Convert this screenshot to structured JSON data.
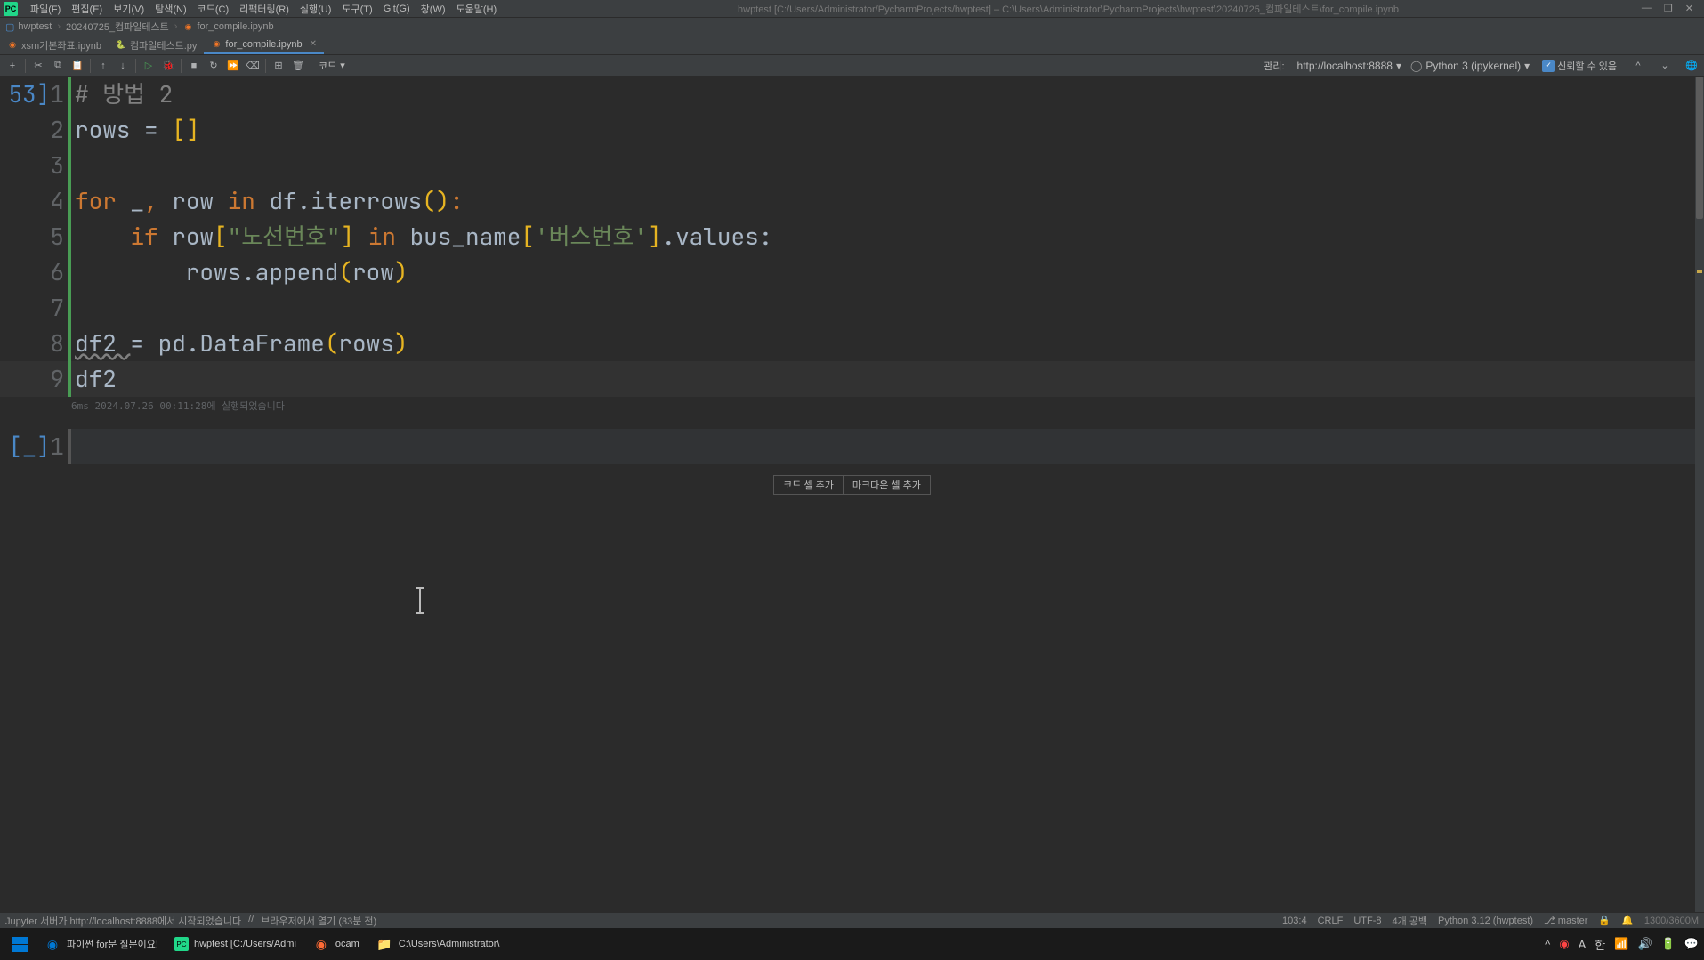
{
  "menubar": {
    "items": [
      "파일(F)",
      "편집(E)",
      "보기(V)",
      "탐색(N)",
      "코드(C)",
      "리팩터링(R)",
      "실행(U)",
      "도구(T)",
      "Git(G)",
      "창(W)",
      "도움말(H)"
    ],
    "title": "hwptest [C:/Users/Administrator/PycharmProjects/hwptest] – C:\\Users\\Administrator\\PycharmProjects\\hwptest\\20240725_컴파일테스트\\for_compile.ipynb"
  },
  "breadcrumb": {
    "items": [
      "hwptest",
      "20240725_컴파일테스트",
      "for_compile.ipynb"
    ]
  },
  "tabs": [
    {
      "name": "xsm기본좌표.ipynb",
      "type": "jupyter",
      "active": false
    },
    {
      "name": "컴파일테스트.py",
      "type": "python",
      "active": false
    },
    {
      "name": "for_compile.ipynb",
      "type": "jupyter",
      "active": true
    }
  ],
  "toolbar": {
    "cell_type": "코드",
    "manage_label": "관리:",
    "server": "http://localhost:8888",
    "kernel": "Python 3 (ipykernel)",
    "trust_label": "신뢰할 수 있음"
  },
  "code_cell": {
    "exec_count": "53",
    "lines": [
      {
        "n": "1",
        "tokens": [
          {
            "t": "# 방법 2",
            "c": "comment"
          }
        ]
      },
      {
        "n": "2",
        "tokens": [
          {
            "t": "rows ",
            "c": "identifier"
          },
          {
            "t": "= ",
            "c": "identifier"
          },
          {
            "t": "[",
            "c": "bracket-y"
          },
          {
            "t": "]",
            "c": "bracket-y"
          }
        ]
      },
      {
        "n": "3",
        "tokens": []
      },
      {
        "n": "4",
        "tokens": [
          {
            "t": "for ",
            "c": "keyword"
          },
          {
            "t": "_",
            "c": "identifier"
          },
          {
            "t": ", ",
            "c": "keyword"
          },
          {
            "t": "row ",
            "c": "identifier"
          },
          {
            "t": "in ",
            "c": "keyword"
          },
          {
            "t": "df.iterrows",
            "c": "identifier"
          },
          {
            "t": "(",
            "c": "bracket-y"
          },
          {
            "t": ")",
            "c": "bracket-y"
          },
          {
            "t": ":",
            "c": "keyword"
          }
        ]
      },
      {
        "n": "5",
        "tokens": [
          {
            "t": "    ",
            "c": ""
          },
          {
            "t": "if ",
            "c": "keyword"
          },
          {
            "t": "row",
            "c": "identifier"
          },
          {
            "t": "[",
            "c": "bracket-y"
          },
          {
            "t": "\"노선번호\"",
            "c": "string"
          },
          {
            "t": "]",
            "c": "bracket-y"
          },
          {
            "t": " ",
            "c": ""
          },
          {
            "t": "in ",
            "c": "keyword"
          },
          {
            "t": "bus_name",
            "c": "identifier"
          },
          {
            "t": "[",
            "c": "bracket-y"
          },
          {
            "t": "'버스번호'",
            "c": "string"
          },
          {
            "t": "]",
            "c": "bracket-y"
          },
          {
            "t": ".values:",
            "c": "identifier"
          }
        ]
      },
      {
        "n": "6",
        "tokens": [
          {
            "t": "        rows.append",
            "c": "identifier"
          },
          {
            "t": "(",
            "c": "bracket-y"
          },
          {
            "t": "row",
            "c": "identifier"
          },
          {
            "t": ")",
            "c": "bracket-y"
          }
        ]
      },
      {
        "n": "7",
        "tokens": []
      },
      {
        "n": "8",
        "tokens": [
          {
            "t": "df2 ",
            "c": "identifier underline"
          },
          {
            "t": "= ",
            "c": "identifier"
          },
          {
            "t": "pd.DataFrame",
            "c": "identifier"
          },
          {
            "t": "(",
            "c": "bracket-y"
          },
          {
            "t": "rows",
            "c": "identifier"
          },
          {
            "t": ")",
            "c": "bracket-y"
          }
        ]
      },
      {
        "n": "9",
        "tokens": [
          {
            "t": "df2",
            "c": "identifier"
          }
        ],
        "hl": true
      }
    ],
    "footer": "6ms 2024.07.26 00:11:28에 실행되었습니다"
  },
  "empty_cell": {
    "label": "[_]",
    "line": "1"
  },
  "add_cell": {
    "code": "코드 셀 추가",
    "markdown": "마크다운 셀 추가"
  },
  "status_bar": {
    "server_msg": "Jupyter 서버가 http://localhost:8888에서 시작되었습니다",
    "sep": "//",
    "browser_open": "브라우저에서 열기 (33분 전)",
    "cursor": "103:4",
    "line_ending": "CRLF",
    "encoding": "UTF-8",
    "indent": "4개 공백",
    "python": "Python 3.12 (hwptest)",
    "git": "master",
    "memory": "1300/3600M"
  },
  "taskbar": {
    "items": [
      {
        "icon": "windows",
        "label": ""
      },
      {
        "icon": "edge",
        "label": "파이썬 for문 질문이요!"
      },
      {
        "icon": "pycharm",
        "label": "hwptest [C:/Users/Admi"
      },
      {
        "icon": "ocam",
        "label": "ocam"
      },
      {
        "icon": "folder",
        "label": "C:\\Users\\Administrator\\"
      }
    ],
    "tray": {
      "lang": "한",
      "input": "A"
    }
  }
}
